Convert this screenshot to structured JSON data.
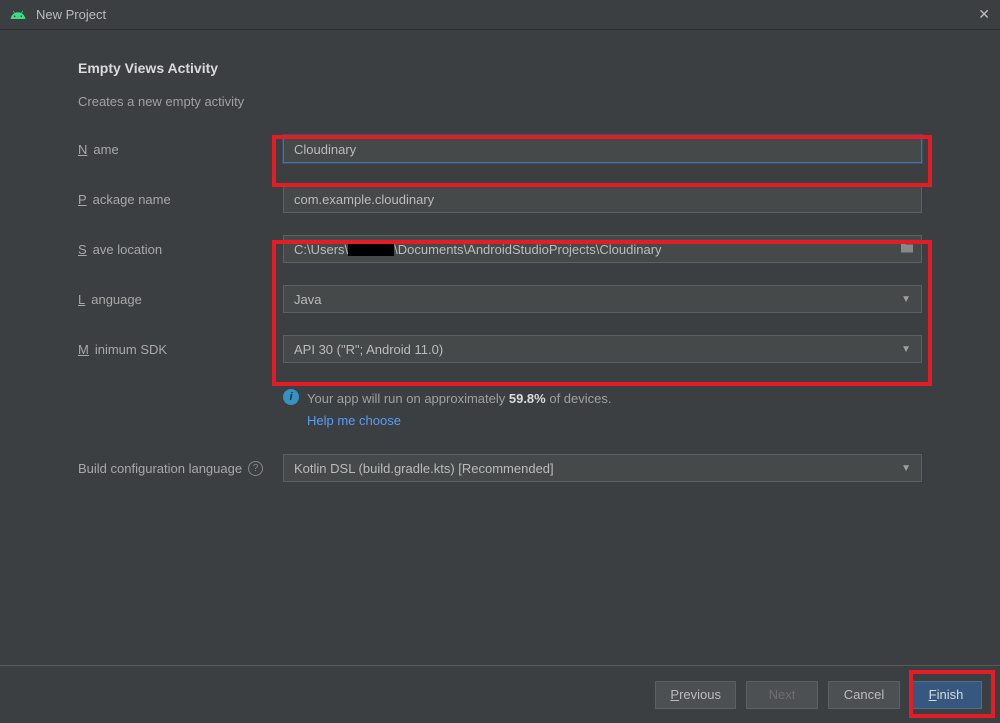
{
  "window": {
    "title": "New Project"
  },
  "heading": "Empty Views Activity",
  "subtitle": "Creates a new empty activity",
  "form": {
    "name": {
      "label": "Name",
      "value": "Cloudinary"
    },
    "package": {
      "label": "Package name",
      "value": "com.example.cloudinary"
    },
    "save": {
      "label": "Save location",
      "prefix": "C:\\Users\\",
      "suffix": "\\Documents\\AndroidStudioProjects\\Cloudinary"
    },
    "language": {
      "label": "Language",
      "value": "Java"
    },
    "minsdk": {
      "label": "Minimum SDK",
      "value": "API 30 (\"R\"; Android 11.0)"
    },
    "buildlang": {
      "label": "Build configuration language",
      "value": "Kotlin DSL (build.gradle.kts) [Recommended]"
    }
  },
  "info": {
    "text_pre": "Your app will run on approximately ",
    "pct": "59.8%",
    "text_post": " of devices.",
    "link": "Help me choose"
  },
  "buttons": {
    "previous": "Previous",
    "next": "Next",
    "cancel": "Cancel",
    "finish": "Finish"
  }
}
